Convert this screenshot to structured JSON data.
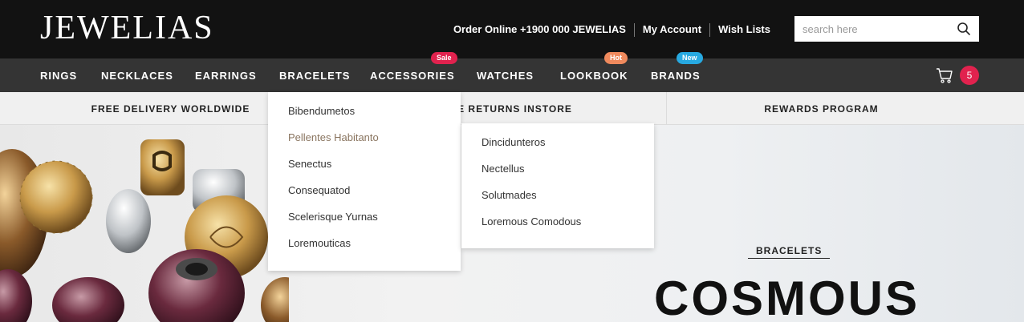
{
  "header": {
    "logo": "JEWELIAS",
    "order_online": "Order Online +1900 000 JEWELIAS",
    "my_account": "My Account",
    "wish_lists": "Wish Lists",
    "search_placeholder": "search here"
  },
  "nav": {
    "items": [
      {
        "label": "RINGS"
      },
      {
        "label": "NECKLACES"
      },
      {
        "label": "EARRINGS"
      },
      {
        "label": "BRACELETS"
      },
      {
        "label": "ACCESSORIES",
        "badge": "Sale",
        "badge_color": "#e1224e"
      },
      {
        "label": "WATCHES"
      },
      {
        "label": "LOOKBOOK",
        "badge": "Hot",
        "badge_color": "#f08a5d"
      },
      {
        "label": "BRANDS",
        "badge": "New",
        "badge_color": "#27a9e1"
      }
    ],
    "cart_count": "5"
  },
  "promo": {
    "items": [
      "FREE DELIVERY WORLDWIDE",
      "FREE RETURNS INSTORE",
      "REWARDS PROGRAM"
    ]
  },
  "dropdown_primary": {
    "items": [
      "Bibendumetos",
      "Pellentes Habitanto",
      "Senectus",
      "Consequatod",
      "Scelerisque Yurnas",
      "Loremouticas"
    ],
    "active_index": 1
  },
  "dropdown_secondary": {
    "items": [
      "Dincidunteros",
      "Nectellus",
      "Solutmades",
      "Loremous Comodous"
    ]
  },
  "hero": {
    "kicker": "BRACELETS",
    "title": "COSMOUS"
  }
}
